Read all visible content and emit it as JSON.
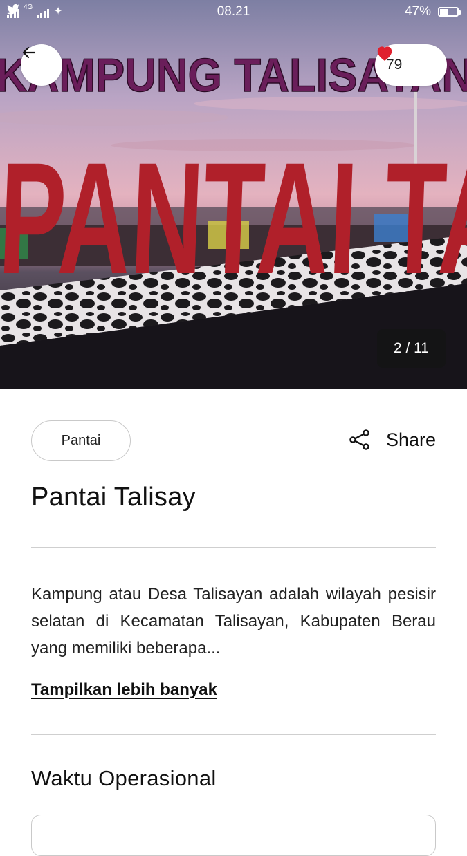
{
  "status_bar": {
    "network": "4G",
    "time": "08.21",
    "battery": "47%",
    "battery_level": 0.47
  },
  "hero": {
    "sign_top_text": "KAMPUNG TALISAYAN",
    "sign_letters": "PANTAI TA",
    "like_count": "79",
    "image_counter": "2 / 11"
  },
  "icons": {
    "back": "arrow-left-icon",
    "like": "heart-icon",
    "share": "share-icon"
  },
  "colors": {
    "heart": "#e0202e",
    "text": "#111111",
    "divider": "#cfcfcf"
  },
  "detail": {
    "category": "Pantai",
    "share_label": "Share",
    "title": "Pantai Talisay",
    "description": "Kampung atau Desa Talisayan adalah wilayah pesisir selatan di Kecamatan Talisayan, Kabupaten Berau yang memiliki beberapa...",
    "show_more": "Tampilkan lebih banyak",
    "hours_heading": "Waktu Operasional"
  }
}
